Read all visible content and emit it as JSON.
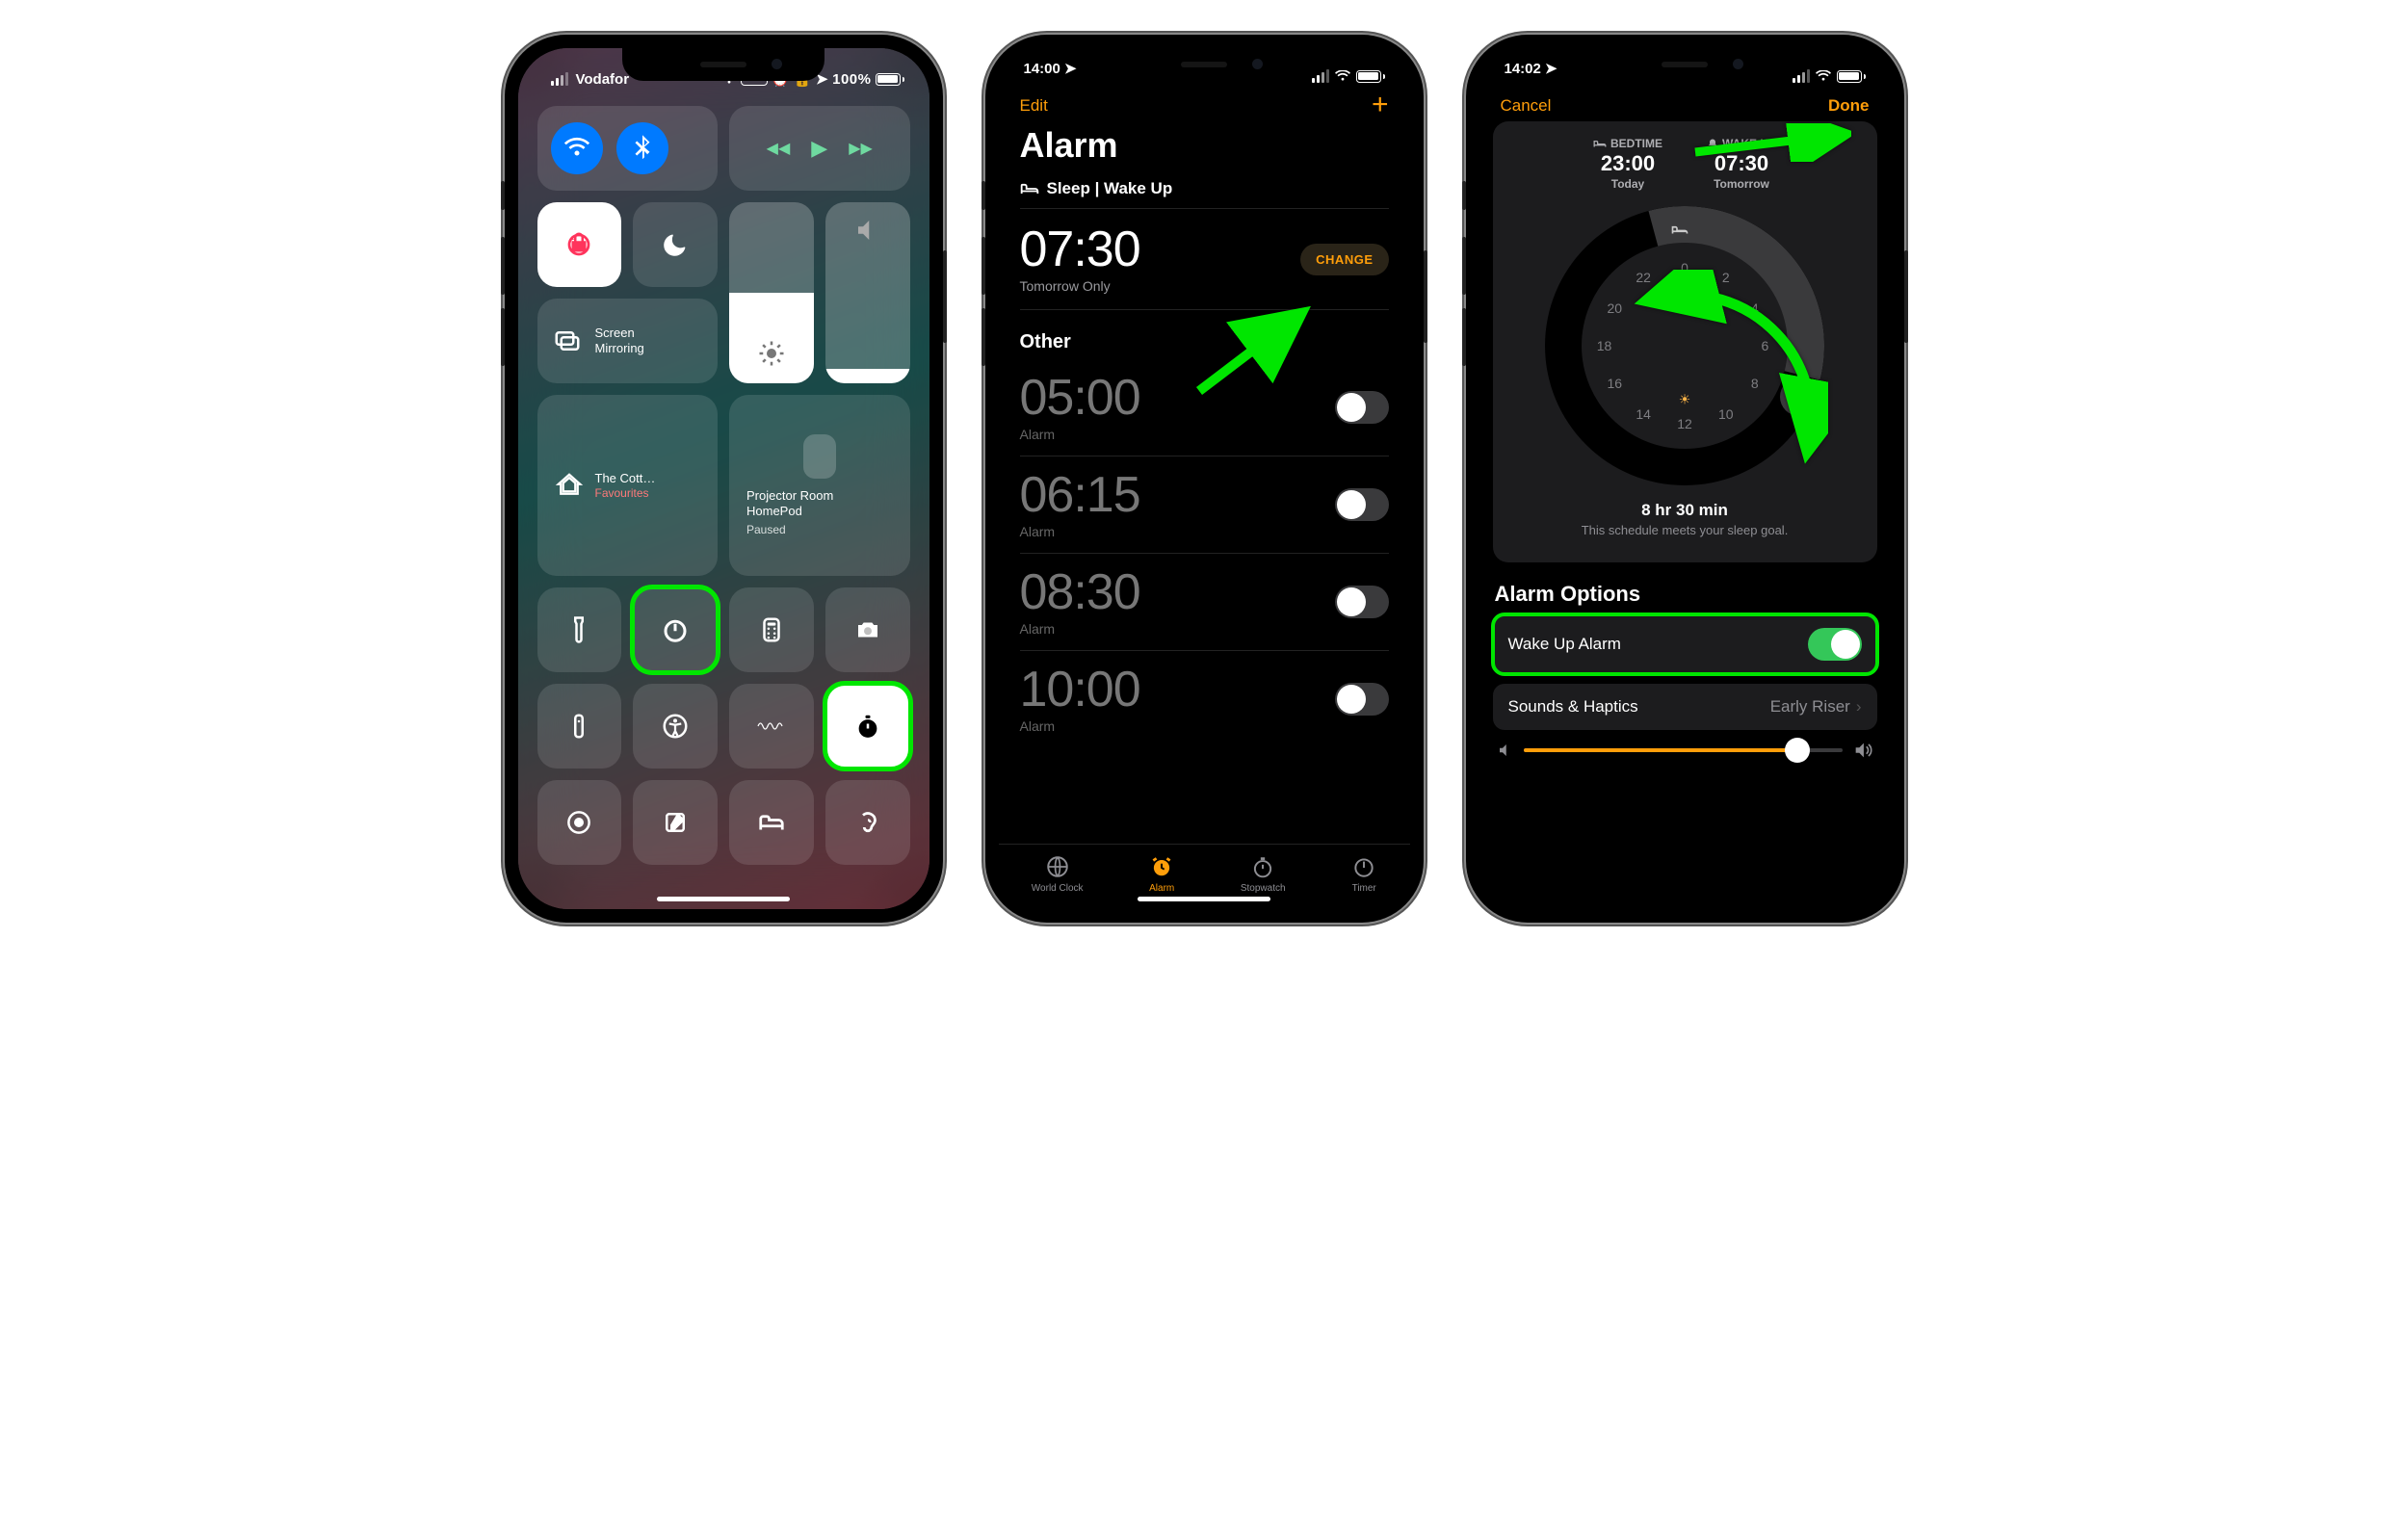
{
  "phone1": {
    "status": {
      "carrier": "Vodafor",
      "vpn": "VPN",
      "battery": "100%"
    },
    "connectivity": {
      "wifi": "wifi-icon",
      "bluetooth": "bluetooth-icon"
    },
    "media": {
      "rew": "◀◀",
      "play": "▶",
      "fwd": "▶▶"
    },
    "orientation_lock": "orientation-lock-icon",
    "dnd": "do-not-disturb-icon",
    "mirroring": {
      "title": "Screen",
      "sub": "Mirroring"
    },
    "home1": {
      "title": "The Cott…",
      "sub": "Favourites"
    },
    "home2": {
      "title": "Projector Room",
      "sub": "HomePod",
      "state": "Paused"
    },
    "icons": [
      "flashlight",
      "timer",
      "calculator",
      "camera",
      "remote",
      "accessibility",
      "voice-memos",
      "stopwatch",
      "screen-record",
      "notes",
      "bedtime",
      "hearing"
    ]
  },
  "phone2": {
    "status": {
      "time": "14:00"
    },
    "nav": {
      "left": "Edit",
      "right": "+"
    },
    "title": "Alarm",
    "sleep_header": "Sleep | Wake Up",
    "sleep": {
      "time": "07:30",
      "sub": "Tomorrow Only",
      "change": "CHANGE"
    },
    "other": "Other",
    "alarms": [
      {
        "time": "05:00",
        "label": "Alarm",
        "on": false
      },
      {
        "time": "06:15",
        "label": "Alarm",
        "on": false
      },
      {
        "time": "08:30",
        "label": "Alarm",
        "on": false
      },
      {
        "time": "10:00",
        "label": "Alarm",
        "on": false
      }
    ],
    "tabs": [
      "World Clock",
      "Alarm",
      "Stopwatch",
      "Timer"
    ]
  },
  "phone3": {
    "status": {
      "time": "14:02"
    },
    "nav": {
      "left": "Cancel",
      "right": "Done"
    },
    "bed": {
      "label": "BEDTIME",
      "time": "23:00",
      "day": "Today"
    },
    "wake": {
      "label": "WAKE UP",
      "time": "07:30",
      "day": "Tomorrow"
    },
    "hours": [
      "0",
      "2",
      "4",
      "6",
      "8",
      "10",
      "12",
      "14",
      "16",
      "18",
      "20",
      "22"
    ],
    "goal": {
      "duration": "8 hr 30 min",
      "msg": "This schedule meets your sleep goal."
    },
    "opts_title": "Alarm Options",
    "wake_alarm": {
      "label": "Wake Up Alarm",
      "on": true
    },
    "sounds": {
      "label": "Sounds & Haptics",
      "value": "Early Riser"
    }
  }
}
